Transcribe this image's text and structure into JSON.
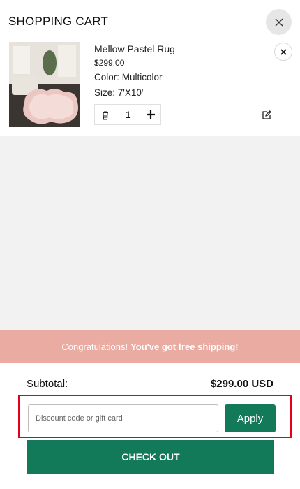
{
  "header": {
    "title": "SHOPPING CART",
    "close_icon": "close-icon"
  },
  "cart_item": {
    "name": "Mellow Pastel Rug",
    "price": "$299.00",
    "color": "Color: Multicolor",
    "size": "Size: 7'X10'",
    "quantity": "1",
    "icons": [
      "trash-icon",
      "plus-icon",
      "edit-icon",
      "remove-icon"
    ]
  },
  "banner": {
    "prefix": "Congratulations!",
    "emphasis": "You've got free shipping!",
    "background": "#eaaca2"
  },
  "summary": {
    "subtotal_label": "Subtotal:",
    "subtotal_value": "$299.00 USD"
  },
  "discount": {
    "placeholder": "Discount code or gift card",
    "apply_label": "Apply"
  },
  "checkout": {
    "label": "CHECK OUT"
  },
  "colors": {
    "accent": "#137a59",
    "highlight_border": "#e3001b"
  }
}
